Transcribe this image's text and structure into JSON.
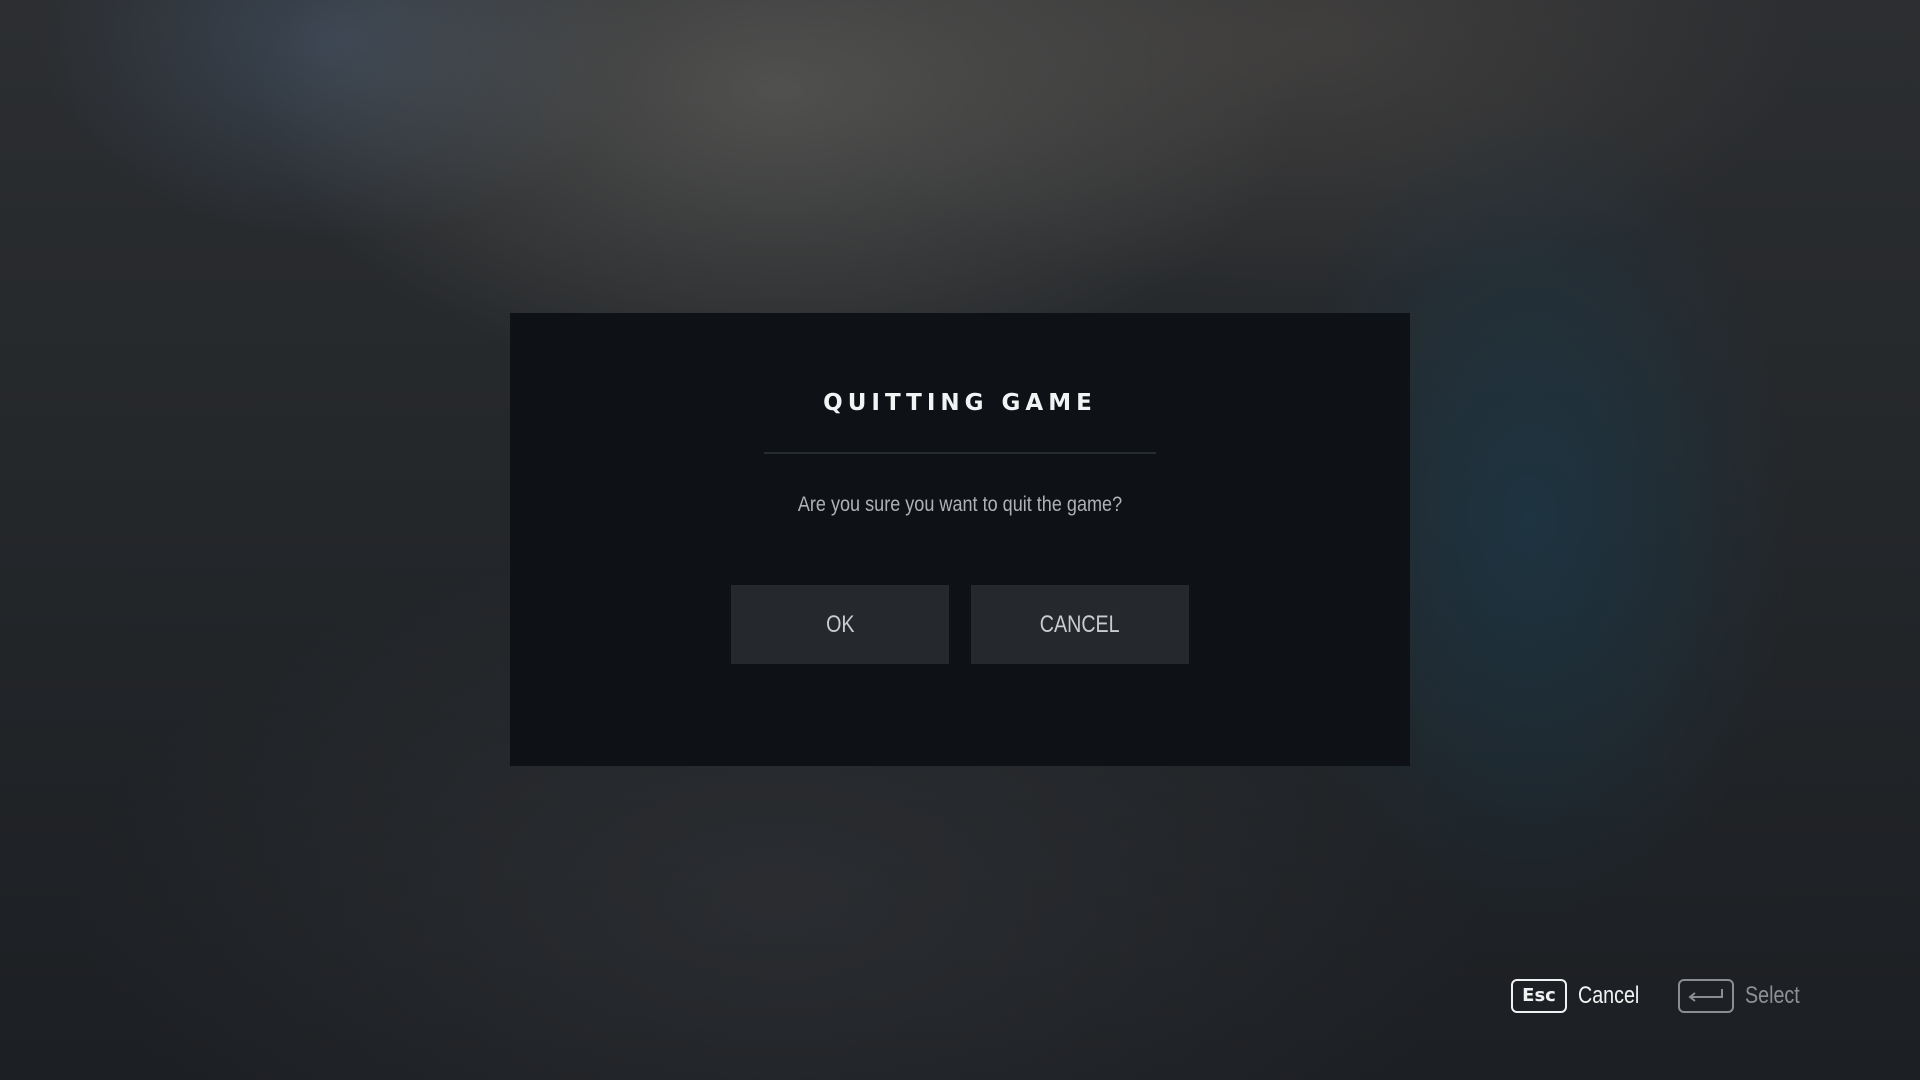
{
  "dialog": {
    "title": "QUITTING GAME",
    "message": "Are you sure you want to quit the game?",
    "buttons": {
      "ok": "OK",
      "cancel": "CANCEL"
    }
  },
  "input_hints": [
    {
      "key": "Esc",
      "label": "Cancel",
      "state": "active"
    },
    {
      "key": "enter-key-icon",
      "label": "Select",
      "state": "dimmed"
    }
  ],
  "colors": {
    "dialog_background": "#0e1216",
    "button_background": "#25292d",
    "title_text": "#f2f3f4",
    "message_text": "#aeb2b6",
    "hint_dim_text": "#8d9195"
  }
}
